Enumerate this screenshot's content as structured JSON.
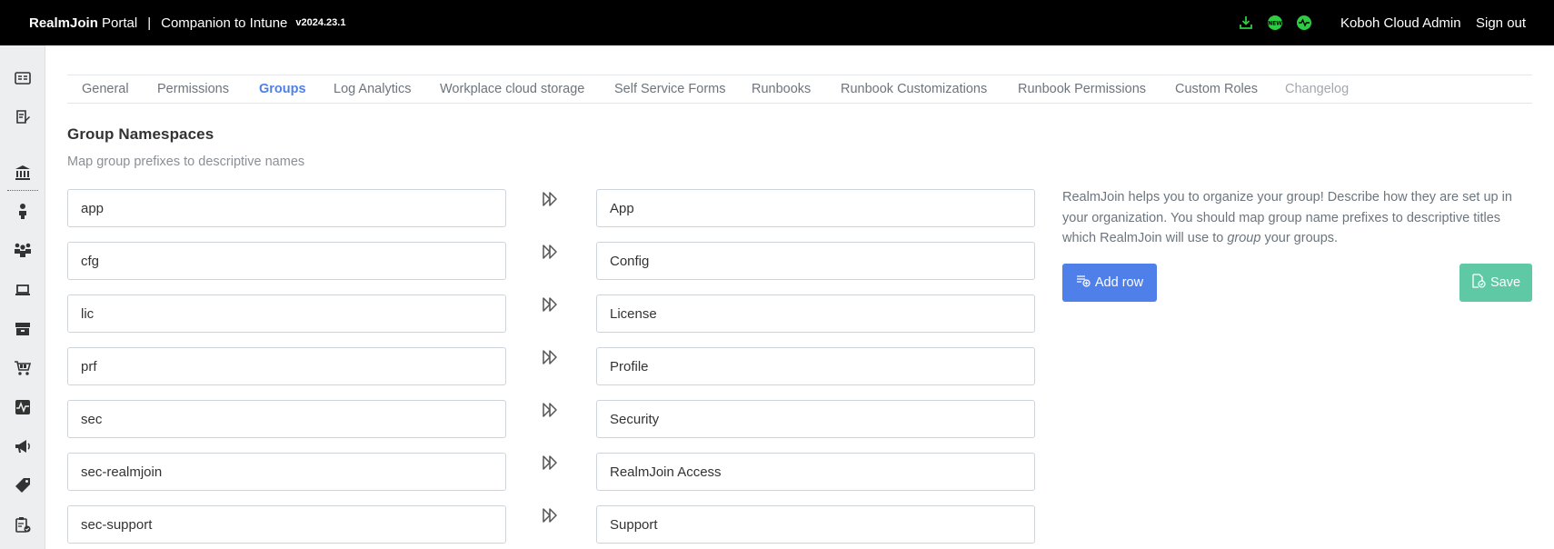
{
  "header": {
    "brand_bold": "RealmJoin",
    "brand_rest": "Portal",
    "separator": "|",
    "subtitle": "Companion to Intune",
    "version": "v2024.23.1",
    "icons": [
      "download-icon",
      "new-badge-icon",
      "heartbeat-icon"
    ],
    "user": "Koboh Cloud Admin",
    "signout": "Sign out"
  },
  "sidebar": {
    "icons": [
      "dashboard-icon",
      "notes-icon",
      "bank-icon",
      "user-icon",
      "users-icon",
      "laptop-icon",
      "package-icon",
      "cart-icon",
      "heartbeat-icon",
      "megaphone-icon",
      "tag-icon",
      "clipboard-check-icon"
    ]
  },
  "tabs": [
    {
      "label": "General"
    },
    {
      "label": "Permissions"
    },
    {
      "label": "Groups"
    },
    {
      "label": "Log Analytics"
    },
    {
      "label": "Workplace cloud storage"
    },
    {
      "label": "Self Service Forms"
    },
    {
      "label": "Runbooks"
    },
    {
      "label": "Runbook Customizations"
    },
    {
      "label": "Runbook Permissions"
    },
    {
      "label": "Custom Roles"
    },
    {
      "label": "Changelog"
    }
  ],
  "section": {
    "title": "Group Namespaces",
    "subtitle": "Map group prefixes to descriptive names"
  },
  "mappings": [
    {
      "prefix": "app",
      "name": "App"
    },
    {
      "prefix": "cfg",
      "name": "Config"
    },
    {
      "prefix": "lic",
      "name": "License"
    },
    {
      "prefix": "prf",
      "name": "Profile"
    },
    {
      "prefix": "sec",
      "name": "Security"
    },
    {
      "prefix": "sec-realmjoin",
      "name": "RealmJoin Access"
    },
    {
      "prefix": "sec-support",
      "name": "Support"
    }
  ],
  "help": {
    "part1": "RealmJoin helps you to organize your group! Describe how they are set up in your organization. You should map group name prefixes to descriptive titles which RealmJoin will use to ",
    "emphasis": "group",
    "part2": " your groups."
  },
  "buttons": {
    "add_row": "Add row",
    "save": "Save"
  },
  "colors": {
    "accent": "#4f7fe8",
    "save": "#5fc9a6",
    "topbar": "#000000",
    "icon_green": "#2ecc40"
  }
}
